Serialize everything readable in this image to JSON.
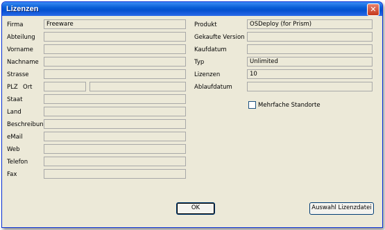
{
  "window": {
    "title": "Lizenzen",
    "close_symbol": "✕"
  },
  "left_fields": {
    "firma": {
      "label": "Firma",
      "value": "Freeware"
    },
    "abteilung": {
      "label": "Abteilung",
      "value": ""
    },
    "vorname": {
      "label": "Vorname",
      "value": ""
    },
    "nachname": {
      "label": "Nachname",
      "value": ""
    },
    "strasse": {
      "label": "Strasse",
      "value": ""
    },
    "plz": {
      "label": "PLZ",
      "value": ""
    },
    "ort": {
      "label": "Ort",
      "value": ""
    },
    "staat": {
      "label": "Staat",
      "value": ""
    },
    "land": {
      "label": "Land",
      "value": ""
    },
    "beschreibung": {
      "label": "Beschreibung",
      "value": ""
    },
    "email": {
      "label": "eMail",
      "value": ""
    },
    "web": {
      "label": "Web",
      "value": ""
    },
    "telefon": {
      "label": "Telefon",
      "value": ""
    },
    "fax": {
      "label": "Fax",
      "value": ""
    }
  },
  "right_fields": {
    "produkt": {
      "label": "Produkt",
      "value": "OSDeploy (for Prism)"
    },
    "gekaufte_version": {
      "label": "Gekaufte Version",
      "value": ""
    },
    "kaufdatum": {
      "label": "Kaufdatum",
      "value": ""
    },
    "typ": {
      "label": "Typ",
      "value": "Unlimited"
    },
    "lizenzen": {
      "label": "Lizenzen",
      "value": "10"
    },
    "ablaufdatum": {
      "label": "Ablaufdatum",
      "value": ""
    }
  },
  "checkbox": {
    "label": "Mehrfache Standorte",
    "checked": false
  },
  "buttons": {
    "ok": "OK",
    "auswahl": "Auswahl Lizenzdatei"
  },
  "colors": {
    "titlebar": "#0a5fd6",
    "dialog_bg": "#ece9d8",
    "close_button": "#c5391c"
  }
}
